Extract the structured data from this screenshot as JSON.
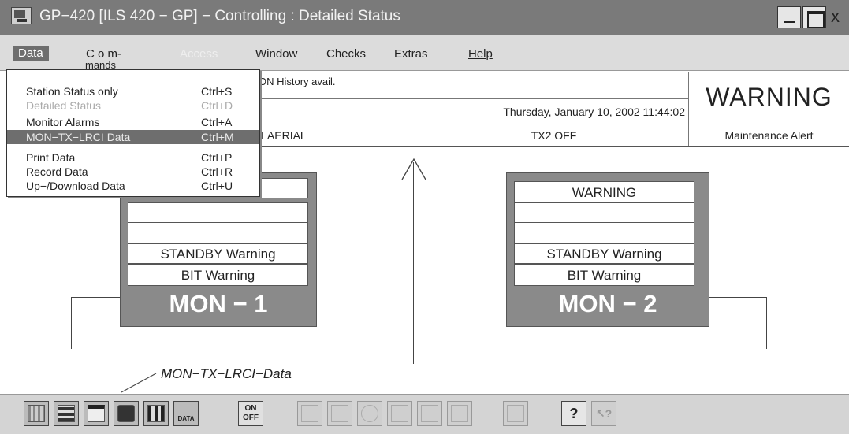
{
  "window": {
    "title": "GP−420 [ILS 420 − GP] − Controlling : Detailed Status",
    "close_glyph": "x"
  },
  "menu": {
    "data": "Data",
    "commands_line1": "C   o   m-",
    "commands_line2": "mands",
    "access": "Access",
    "window": "Window",
    "checks": "Checks",
    "extras": "Extras",
    "help": "Help"
  },
  "data_menu": {
    "items": [
      {
        "label": "Station Status only",
        "shortcut": "Ctrl+S",
        "state": "normal"
      },
      {
        "label": "Detailed Status",
        "shortcut": "Ctrl+D",
        "state": "disabled"
      },
      {
        "label": "Monitor Alarms",
        "shortcut": "Ctrl+A",
        "state": "normal"
      },
      {
        "label": "MON−TX−LRCI Data",
        "shortcut": "Ctrl+M",
        "state": "selected"
      },
      {
        "label": "Print Data",
        "shortcut": "Ctrl+P",
        "state": "normal"
      },
      {
        "label": "Record Data",
        "shortcut": "Ctrl+R",
        "state": "normal"
      },
      {
        "label": "Up−/Download Data",
        "shortcut": "Ctrl+U",
        "state": "normal"
      }
    ]
  },
  "status_panel": {
    "history": "ON History avail.",
    "datetime": "Thursday, January 10, 2002   11:44:02",
    "warning": "WARNING",
    "aerial": "1 AERIAL",
    "tx2": "TX2 OFF",
    "maintenance": "Maintenance Alert"
  },
  "mon1": {
    "slots": [
      "",
      "",
      "",
      "STANDBY Warning",
      "BIT Warning"
    ],
    "label": "MON  −  1"
  },
  "mon2": {
    "slots": [
      "WARNING",
      "",
      "",
      "STANDBY Warning",
      "BIT Warning"
    ],
    "label": "MON  −  2"
  },
  "annotation": "MON−TX−LRCI−Data",
  "toolbar": {
    "on_off_top": "ON",
    "on_off_bottom": "OFF",
    "data_label": "DATA",
    "help_glyph": "?",
    "help_arrow_glyph": "↖?"
  },
  "colors": {
    "title_bar": "#7a7a7a",
    "menu_bar": "#dcdcdc",
    "panel_gray": "#8a8a8a",
    "selection": "#6e6e6e"
  }
}
